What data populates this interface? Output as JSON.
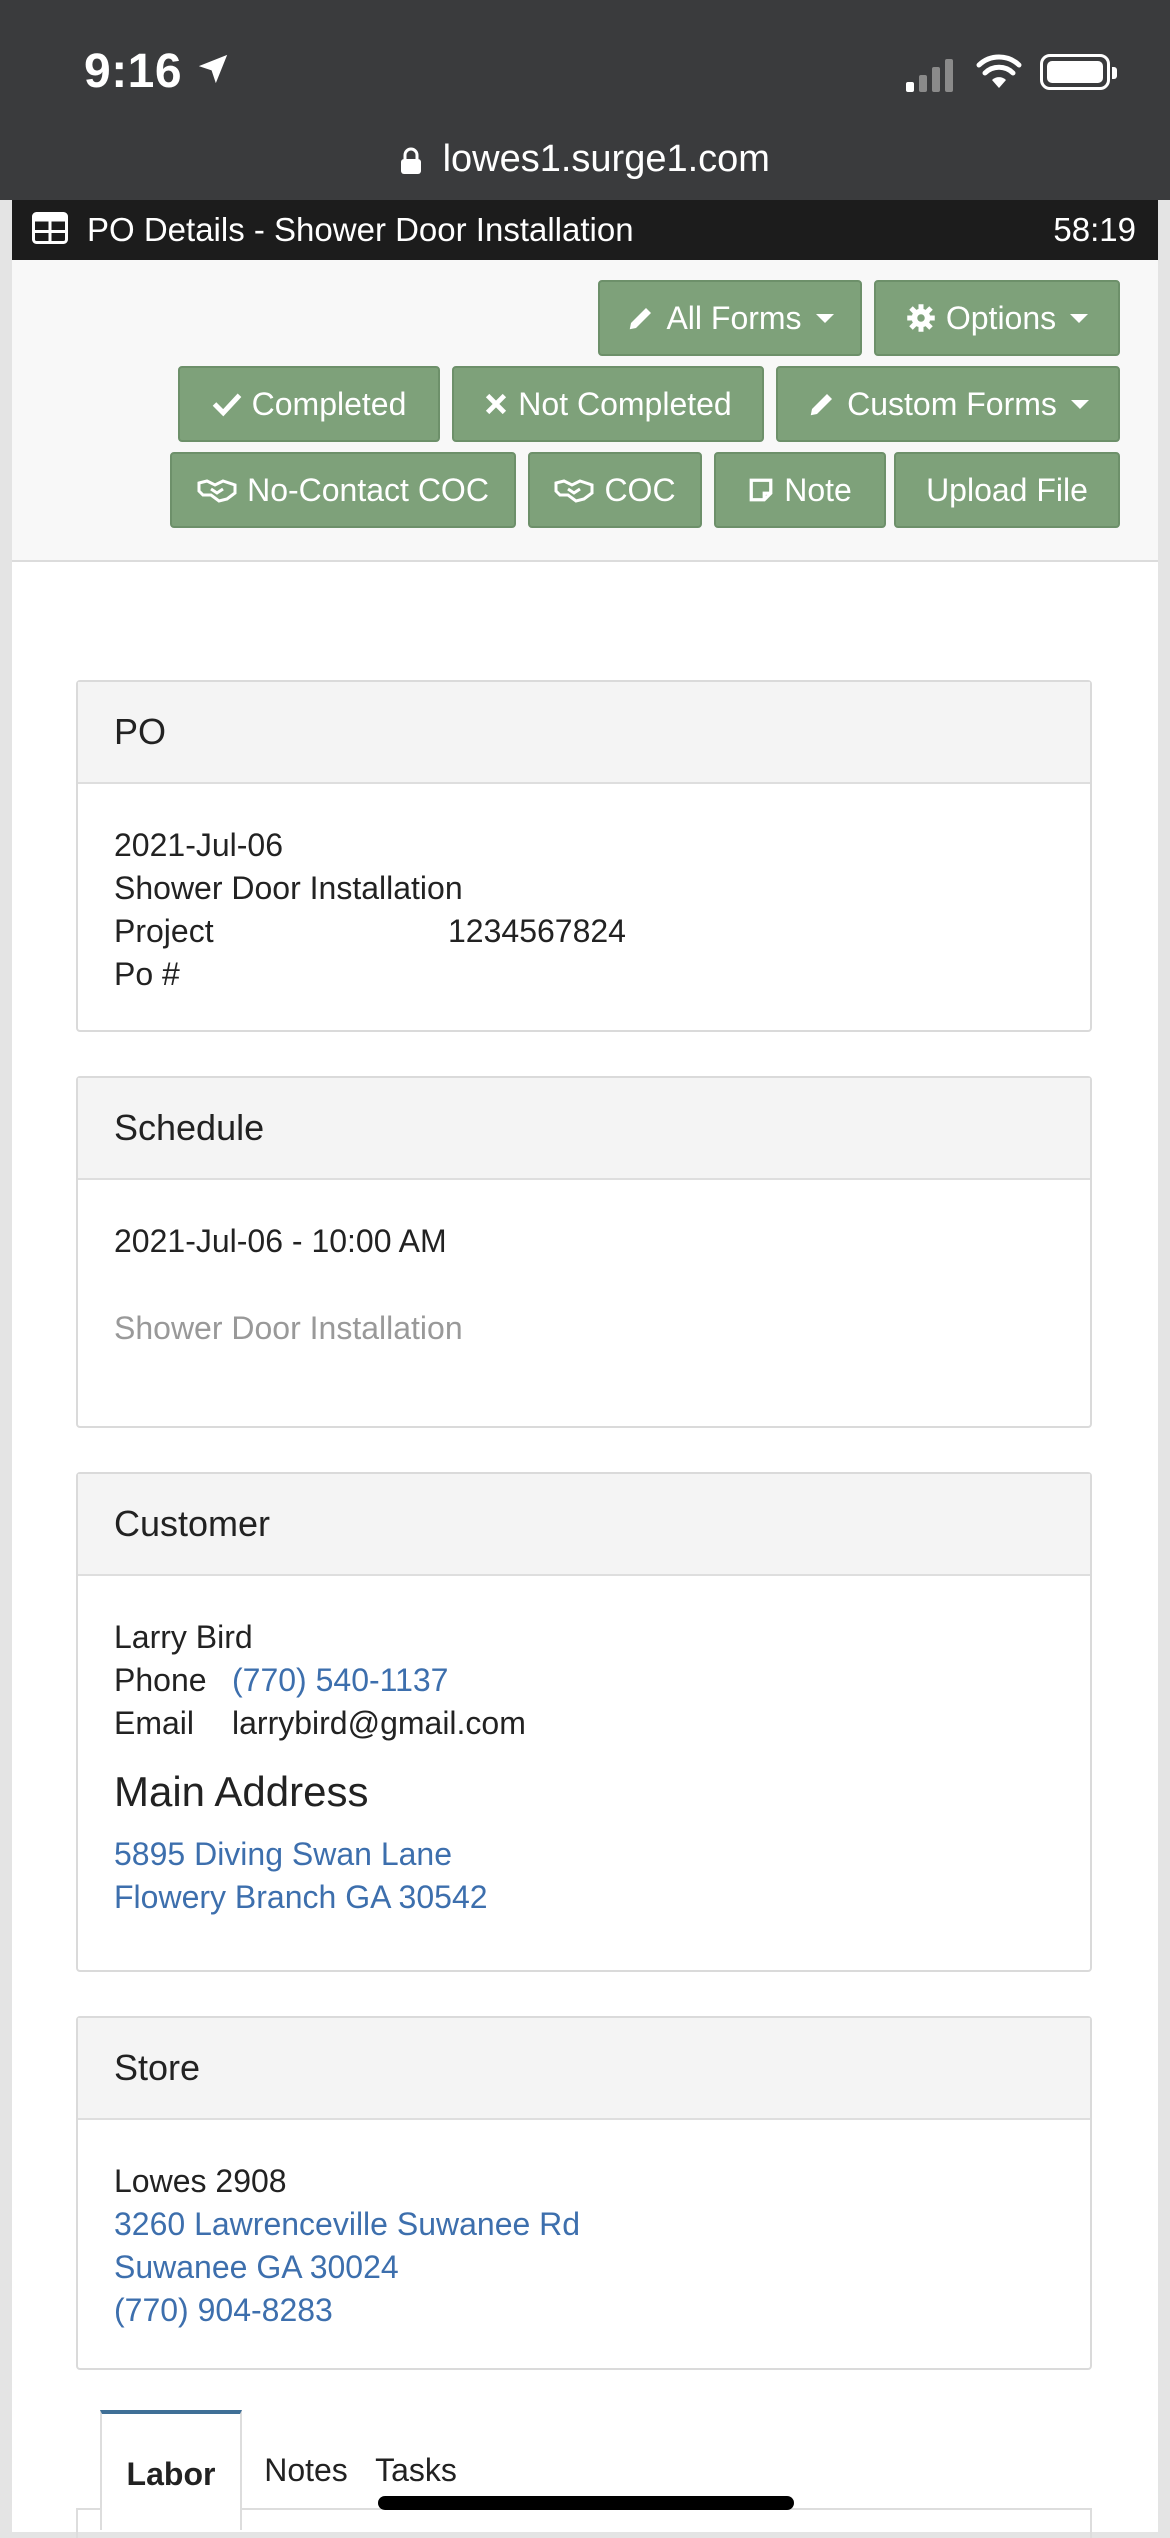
{
  "status_bar": {
    "time": "9:16",
    "url": "lowes1.surge1.com"
  },
  "titlebar": {
    "title": "PO Details - Shower Door Installation",
    "timer": "58:19"
  },
  "toolbar": {
    "all_forms": "All Forms",
    "options": "Options",
    "completed": "Completed",
    "not_completed": "Not Completed",
    "custom_forms": "Custom Forms",
    "no_contact_coc": "No-Contact COC",
    "coc": "COC",
    "note": "Note",
    "upload_file": "Upload File",
    "button_color": "#7ea17a"
  },
  "po": {
    "heading": "PO",
    "date": "2021-Jul-06",
    "service": "Shower Door Installation",
    "project_label": "Project",
    "project_value": "1234567824",
    "po_label": "Po #",
    "po_value": ""
  },
  "schedule": {
    "heading": "Schedule",
    "datetime": "2021-Jul-06 - 10:00 AM",
    "description": "Shower Door Installation"
  },
  "customer": {
    "heading": "Customer",
    "name": "Larry Bird",
    "phone_label": "Phone",
    "phone": "(770) 540-1137",
    "email_label": "Email",
    "email": "larrybird@gmail.com",
    "address_heading": "Main Address",
    "address_line1": "5895 Diving Swan Lane",
    "address_line2": "Flowery Branch GA 30542"
  },
  "store": {
    "heading": "Store",
    "name": "Lowes 2908",
    "address_line1": "3260 Lawrenceville Suwanee Rd",
    "address_line2": "Suwanee GA 30024",
    "phone": "(770) 904-8283"
  },
  "tabs": {
    "labor": "Labor",
    "notes": "Notes",
    "tasks": "Tasks",
    "active": "Labor"
  },
  "colors": {
    "link": "#3d6fad",
    "titlebar": "#1c1c1c",
    "status_bar": "#3a3b3d"
  }
}
